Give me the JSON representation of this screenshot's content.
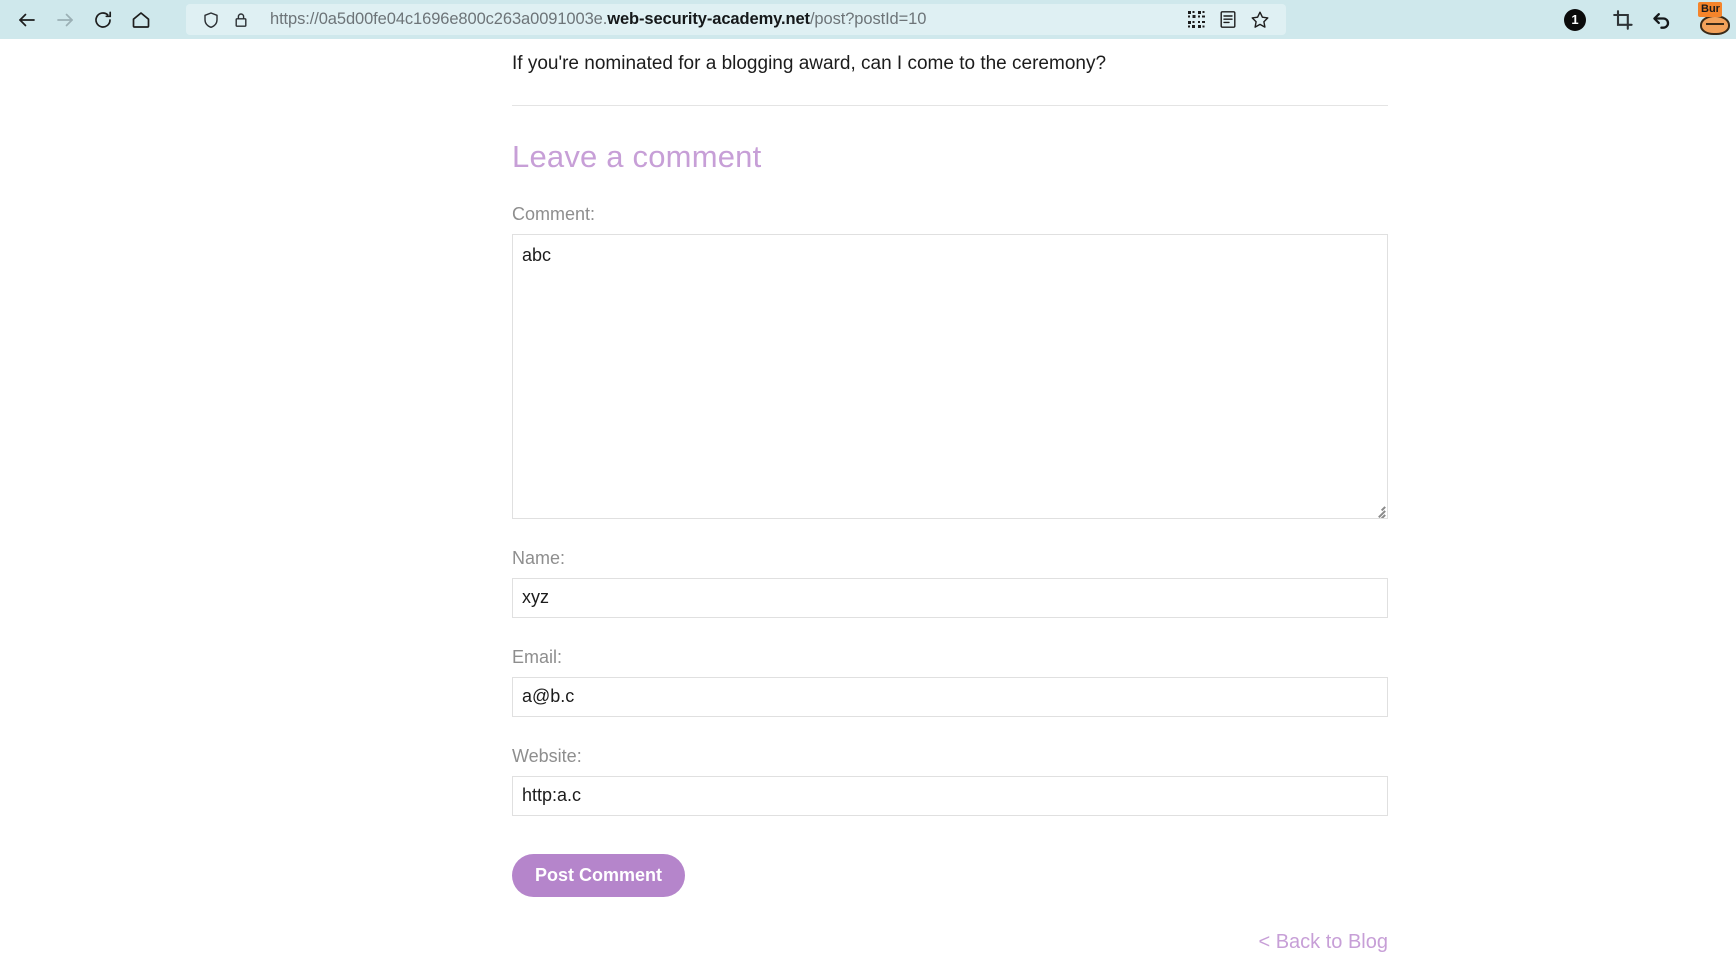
{
  "browser": {
    "nav": {
      "back": "back-arrow",
      "forward": "forward-arrow",
      "reload": "reload-arrow",
      "home": "home-house"
    },
    "url": {
      "scheme_host_prefix": "https://0a5d00fe04c1696e800c263a0091003e.",
      "host": "web-security-academy.net",
      "path": "/post?postId=10",
      "full": "https://0a5d00fe04c1696e800c263a0091003e.web-security-academy.net/post?postId=10"
    },
    "urlbar_icons": [
      "shield-icon",
      "lock-icon"
    ],
    "urlbar_actions": [
      "qr-code-icon",
      "reader-view-icon",
      "bookmark-star-icon"
    ],
    "toolbar_right": {
      "notification_count": "1",
      "crop_icon": "crop-icon",
      "undo_icon": "undo-arrow-icon",
      "extension_label": "Bur",
      "extension_name": "burp-suite-extension"
    }
  },
  "post": {
    "question": "If you're nominated for a blogging award, can I come to the ceremony?"
  },
  "comment_form": {
    "heading": "Leave a comment",
    "comment": {
      "label": "Comment:",
      "value": "abc"
    },
    "name": {
      "label": "Name:",
      "value": "xyz"
    },
    "email": {
      "label": "Email:",
      "value": "a@b.c"
    },
    "website": {
      "label": "Website:",
      "value": "http:a.c"
    },
    "submit_label": "Post Comment",
    "back_link": "< Back to Blog"
  },
  "colors": {
    "accent_purple": "#c79fd7",
    "button_purple": "#b585cb",
    "chrome_bg": "#cfe8ec",
    "urlbar_bg": "#dff0f3",
    "burp_orange": "#f5842a"
  }
}
